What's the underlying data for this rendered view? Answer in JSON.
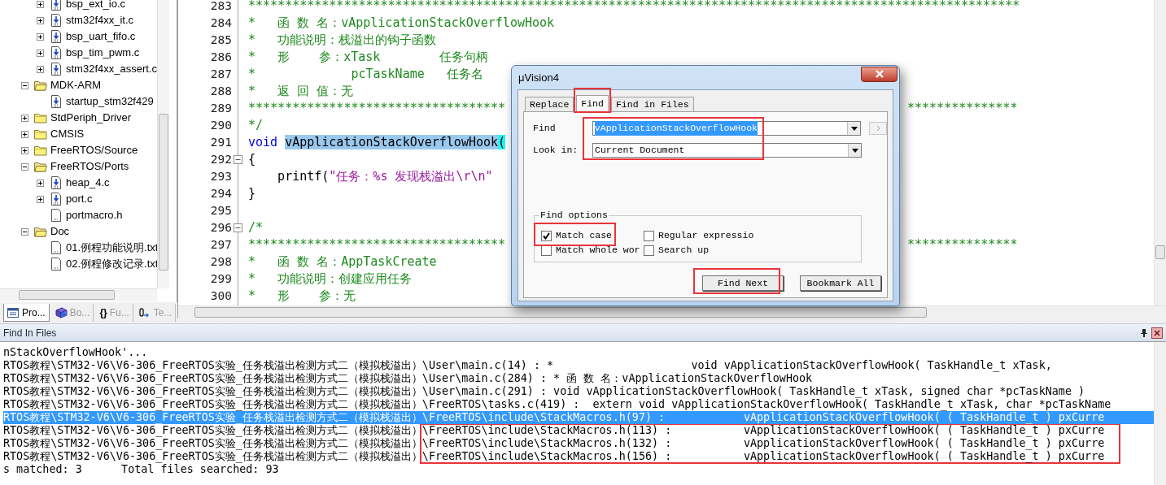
{
  "project_tree": {
    "orphan_items": [
      {
        "label": "bsp_ext_io.c",
        "kind": "source",
        "expandable": true
      },
      {
        "label": "stm32f4xx_it.c",
        "kind": "source",
        "expandable": true
      },
      {
        "label": "bsp_uart_fifo.c",
        "kind": "source",
        "expandable": true
      },
      {
        "label": "bsp_tim_pwm.c",
        "kind": "source",
        "expandable": true
      },
      {
        "label": "stm32f4xx_assert.c",
        "kind": "source",
        "expandable": true
      }
    ],
    "folders": [
      {
        "label": "MDK-ARM",
        "expanded": true,
        "children": [
          {
            "label": "startup_stm32f429",
            "kind": "source",
            "expandable": false
          }
        ]
      },
      {
        "label": "StdPeriph_Driver",
        "expanded": false
      },
      {
        "label": "CMSIS",
        "expanded": false
      },
      {
        "label": "FreeRTOS/Source",
        "expanded": false
      },
      {
        "label": "FreeRTOS/Ports",
        "expanded": true,
        "children": [
          {
            "label": "heap_4.c",
            "kind": "source",
            "expandable": true
          },
          {
            "label": "port.c",
            "kind": "source",
            "expandable": true
          },
          {
            "label": "portmacro.h",
            "kind": "text",
            "expandable": false
          }
        ]
      },
      {
        "label": "Doc",
        "expanded": true,
        "children": [
          {
            "label": "01.例程功能说明.txt",
            "kind": "text",
            "expandable": false
          },
          {
            "label": "02.例程修改记录.txt",
            "kind": "text",
            "expandable": false
          }
        ]
      }
    ]
  },
  "panel_tabs": [
    {
      "label": "Pro...",
      "kind": "project",
      "selected": true
    },
    {
      "label": "Bo...",
      "kind": "books",
      "selected": false
    },
    {
      "label": "Fu...",
      "kind": "functions",
      "glyph": "{}",
      "selected": false
    },
    {
      "label": "Te...",
      "kind": "templates",
      "selected": false
    }
  ],
  "editor": {
    "lines": [
      {
        "number": "283",
        "segments": [
          {
            "kind": "comment",
            "text": "*********************************************************************************************************"
          }
        ]
      },
      {
        "number": "284",
        "segments": [
          {
            "kind": "comment",
            "text": "*   函 数 名：vApplicationStackOverflowHook"
          }
        ]
      },
      {
        "number": "285",
        "segments": [
          {
            "kind": "comment",
            "text": "*   功能说明：栈溢出的钩子函数"
          }
        ]
      },
      {
        "number": "286",
        "segments": [
          {
            "kind": "comment",
            "text": "*   形    参：xTask        任务句柄"
          }
        ]
      },
      {
        "number": "287",
        "segments": [
          {
            "kind": "comment",
            "text": "*             pcTaskName   任务名"
          }
        ]
      },
      {
        "number": "288",
        "segments": [
          {
            "kind": "comment",
            "text": "*   返 回 值：无"
          }
        ]
      },
      {
        "number": "289",
        "segments": [
          {
            "kind": "comment",
            "text": "***********************************"
          }
        ],
        "right_segments": [
          {
            "kind": "comment",
            "text": "***************"
          }
        ]
      },
      {
        "number": "290",
        "segments": [
          {
            "kind": "comment",
            "text": "*/"
          }
        ]
      },
      {
        "number": "291",
        "segments": [
          {
            "kind": "keyword",
            "text": "void "
          },
          {
            "kind": "selected",
            "text": "vApplicationStackOverflowHook"
          },
          {
            "kind": "brace",
            "text": "("
          }
        ]
      },
      {
        "number": "292",
        "fold_start": true,
        "segments": [
          {
            "kind": "plain",
            "text": "{"
          }
        ]
      },
      {
        "number": "293",
        "segments": [
          {
            "kind": "plain",
            "text": "    printf("
          },
          {
            "kind": "string",
            "text": "\"任务：%s 发现栈溢出\\r\\n\""
          }
        ]
      },
      {
        "number": "294",
        "segments": [
          {
            "kind": "plain",
            "text": "}"
          }
        ]
      },
      {
        "number": "295"
      },
      {
        "number": "296",
        "fold_start": true,
        "segments": [
          {
            "kind": "comment",
            "text": "/*"
          }
        ]
      },
      {
        "number": "297",
        "segments": [
          {
            "kind": "comment",
            "text": "***********************************"
          }
        ],
        "right_segments": [
          {
            "kind": "comment",
            "text": "***************"
          }
        ]
      },
      {
        "number": "298",
        "segments": [
          {
            "kind": "comment",
            "text": "*   函 数 名：AppTaskCreate"
          }
        ]
      },
      {
        "number": "299",
        "segments": [
          {
            "kind": "comment",
            "text": "*   功能说明：创建应用任务"
          }
        ]
      },
      {
        "number": "300",
        "segments": [
          {
            "kind": "comment",
            "text": "*   形    参：无"
          }
        ]
      }
    ]
  },
  "dialog": {
    "title": "μVision4",
    "tabs": [
      {
        "label": "Replace",
        "selected": false,
        "highlighted": false
      },
      {
        "label": "Find",
        "selected": true,
        "highlighted": true
      },
      {
        "label": "Find in Files",
        "selected": false,
        "highlighted": false
      }
    ],
    "find": {
      "label": "Find",
      "value": "vApplicationStackOverflowHook",
      "value_selected": true
    },
    "look_in": {
      "label": "Look in:",
      "value": "Current Document"
    },
    "fields_highlighted": true,
    "options_title": "Find options",
    "options": [
      {
        "label": "Match case",
        "checked": true,
        "highlighted": true
      },
      {
        "label": "Regular expressio",
        "checked": false,
        "highlighted": false
      },
      {
        "label": "Match whole wor",
        "checked": false,
        "highlighted": false
      },
      {
        "label": "Search up",
        "checked": false,
        "highlighted": false
      }
    ],
    "buttons": [
      {
        "label": "Find Next",
        "highlighted": true
      },
      {
        "label": "Bookmark All",
        "highlighted": false
      }
    ]
  },
  "find_results": {
    "title": "Find In Files",
    "rows": [
      {
        "text": "nStackOverflowHook'...",
        "selected": false,
        "highlighted": false
      },
      {
        "text": "RTOS教程\\STM32-V6\\V6-306_FreeRTOS实验_任务栈溢出检测方式二（模拟栈溢出）\\User\\main.c(14) : *                     void vApplicationStackOverflowHook( TaskHandle_t xTask,",
        "selected": false,
        "highlighted": false
      },
      {
        "text": "RTOS教程\\STM32-V6\\V6-306_FreeRTOS实验_任务栈溢出检测方式二（模拟栈溢出）\\User\\main.c(284) : * 函 数 名：vApplicationStackOverflowHook",
        "selected": false,
        "highlighted": false
      },
      {
        "text": "RTOS教程\\STM32-V6\\V6-306_FreeRTOS实验_任务栈溢出检测方式二（模拟栈溢出）\\User\\main.c(291) : void vApplicationStackOverflowHook( TaskHandle_t xTask, signed char *pcTaskName )",
        "selected": false,
        "highlighted": false
      },
      {
        "text": "RTOS教程\\STM32-V6\\V6-306_FreeRTOS实验_任务栈溢出检测方式二（模拟栈溢出）\\FreeRTOS\\tasks.c(419) :  extern void vApplicationStackOverflowHook( TaskHandle_t xTask, char *pcTaskName",
        "selected": false,
        "highlighted": false
      },
      {
        "text": "RTOS教程\\STM32-V6\\V6-306_FreeRTOS实验_任务栈溢出检测方式二（模拟栈溢出）\\FreeRTOS\\include\\StackMacros.h(97) :            vApplicationStackOverflowHook( ( TaskHandle_t ) pxCurre",
        "selected": true,
        "highlighted": false
      },
      {
        "text": "RTOS教程\\STM32-V6\\V6-306_FreeRTOS实验_任务栈溢出检测方式二（模拟栈溢出）\\FreeRTOS\\include\\StackMacros.h(113) :           vApplicationStackOverflowHook( ( TaskHandle_t ) pxCurre",
        "selected": false,
        "highlighted": true
      },
      {
        "text": "RTOS教程\\STM32-V6\\V6-306_FreeRTOS实验_任务栈溢出检测方式二（模拟栈溢出）\\FreeRTOS\\include\\StackMacros.h(132) :           vApplicationStackOverflowHook( ( TaskHandle_t ) pxCurre",
        "selected": false,
        "highlighted": true
      },
      {
        "text": "RTOS教程\\STM32-V6\\V6-306_FreeRTOS实验_任务栈溢出检测方式二（模拟栈溢出）\\FreeRTOS\\include\\StackMacros.h(156) :           vApplicationStackOverflowHook( ( TaskHandle_t ) pxCurre",
        "selected": false,
        "highlighted": true
      }
    ],
    "summary": "s matched: 3      Total files searched: 93"
  }
}
